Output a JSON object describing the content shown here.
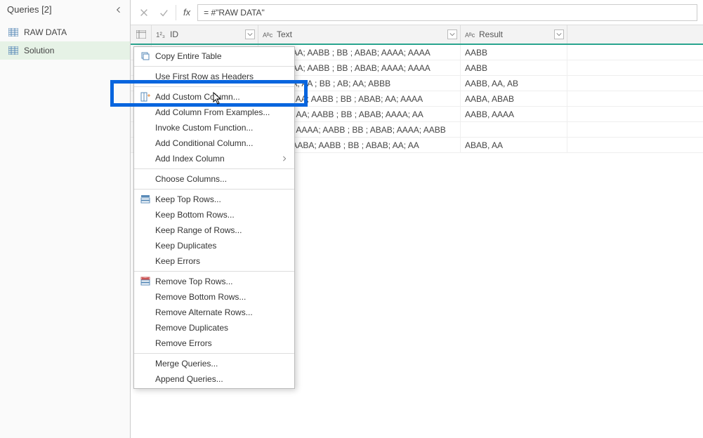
{
  "queries": {
    "title": "Queries [2]",
    "items": [
      {
        "name": "RAW DATA"
      },
      {
        "name": "Solution"
      }
    ]
  },
  "formula": "= #\"RAW DATA\"",
  "columns": {
    "id": "ID",
    "text": "Text",
    "result": "Result"
  },
  "rows": [
    {
      "text_partial": "AABB ; AA; AABB ; BB ; ABAB; AAAA; AAAA",
      "result": "AABB"
    },
    {
      "text_partial": "AABB ; AA; AABB ; BB ; ABAB; AAAA; AAAA",
      "result": "AABB"
    },
    {
      "text_partial": "ABB ; AA; AA ; BB ; AB; AA; ABBB",
      "result": "AABB, AA, AB"
    },
    {
      "text_partial": " ; AABA ; AA; AABB ; BB ; ABAB; AA; AAAA",
      "result": "AABA, ABAB"
    },
    {
      "text_partial": " ; AABB ; AA; AABB ; BB ; ABAB; AAAA; AA",
      "result": "AABB, AAAA"
    },
    {
      "text_partial": " ; AABB ; AAAA; AABB ; BB ; ABAB; AAAA; AABB",
      "result": ""
    },
    {
      "text_partial": "AABB ; AABA; AABB ; BB ; ABAB; AA; AA",
      "result": "ABAB, AA"
    }
  ],
  "menu": {
    "copy_table": "Copy Entire Table",
    "first_row_headers": "Use First Row as Headers",
    "add_custom_column": "Add Custom Column...",
    "add_column_examples": "Add Column From Examples...",
    "invoke_custom_fn": "Invoke Custom Function...",
    "add_conditional": "Add Conditional Column...",
    "add_index": "Add Index Column",
    "choose_columns": "Choose Columns...",
    "keep_top": "Keep Top Rows...",
    "keep_bottom": "Keep Bottom Rows...",
    "keep_range": "Keep Range of Rows...",
    "keep_duplicates": "Keep Duplicates",
    "keep_errors": "Keep Errors",
    "remove_top": "Remove Top Rows...",
    "remove_bottom": "Remove Bottom Rows...",
    "remove_alternate": "Remove Alternate Rows...",
    "remove_duplicates": "Remove Duplicates",
    "remove_errors": "Remove Errors",
    "merge_queries": "Merge Queries...",
    "append_queries": "Append Queries..."
  }
}
